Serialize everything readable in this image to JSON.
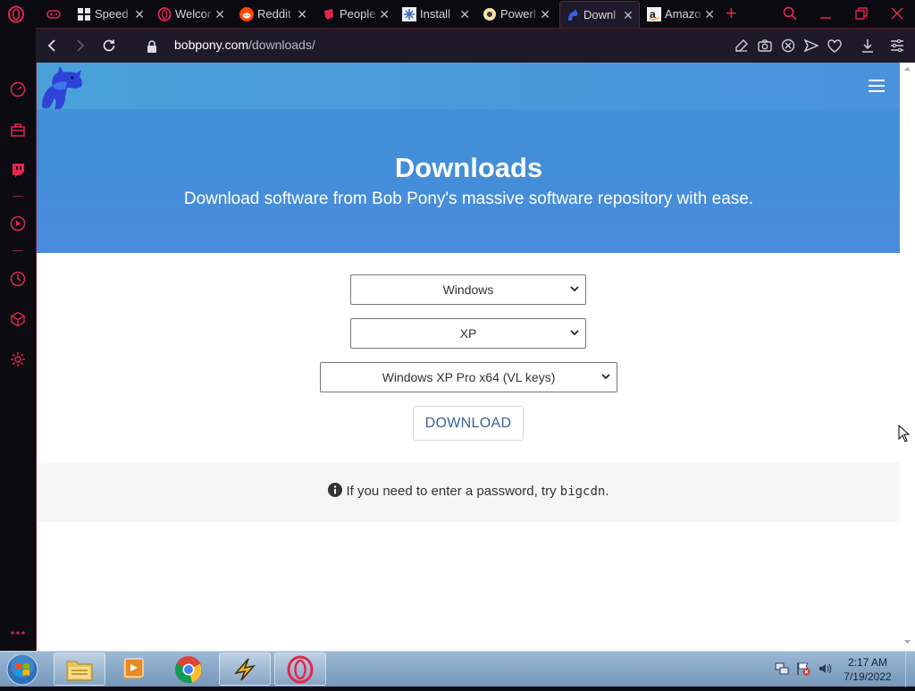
{
  "browser": {
    "tabs": [
      {
        "title": "",
        "icon": "gamepad-icon"
      },
      {
        "title": "Speed",
        "icon": "speed-dial-icon"
      },
      {
        "title": "Welcor",
        "icon": "opera-icon"
      },
      {
        "title": "Reddit",
        "icon": "reddit-icon"
      },
      {
        "title": "People",
        "icon": "pinterest-icon"
      },
      {
        "title": "Install",
        "icon": "settings-favicon-icon"
      },
      {
        "title": "Powerl",
        "icon": "powerline-icon"
      },
      {
        "title": "Downl",
        "icon": "bobpony-favicon-icon",
        "active": true
      },
      {
        "title": "Amazo",
        "icon": "amazon-icon"
      }
    ],
    "url_domain": "bobpony.com",
    "url_path": "/downloads/"
  },
  "page": {
    "title": "Downloads",
    "subtitle": "Download software from Bob Pony's massive software repository with ease.",
    "selects": {
      "os": "Windows",
      "version": "XP",
      "edition": "Windows XP Pro x64 (VL keys)"
    },
    "download_label": "DOWNLOAD",
    "note_text": "If you need to enter a password, try ",
    "note_code": "bigcdn",
    "note_end": "."
  },
  "taskbar": {
    "time": "2:17 AM",
    "date": "7/19/2022"
  },
  "colors": {
    "accent": "#e0284f",
    "hero": "#4a93da",
    "download_text": "#3a5f9a"
  }
}
